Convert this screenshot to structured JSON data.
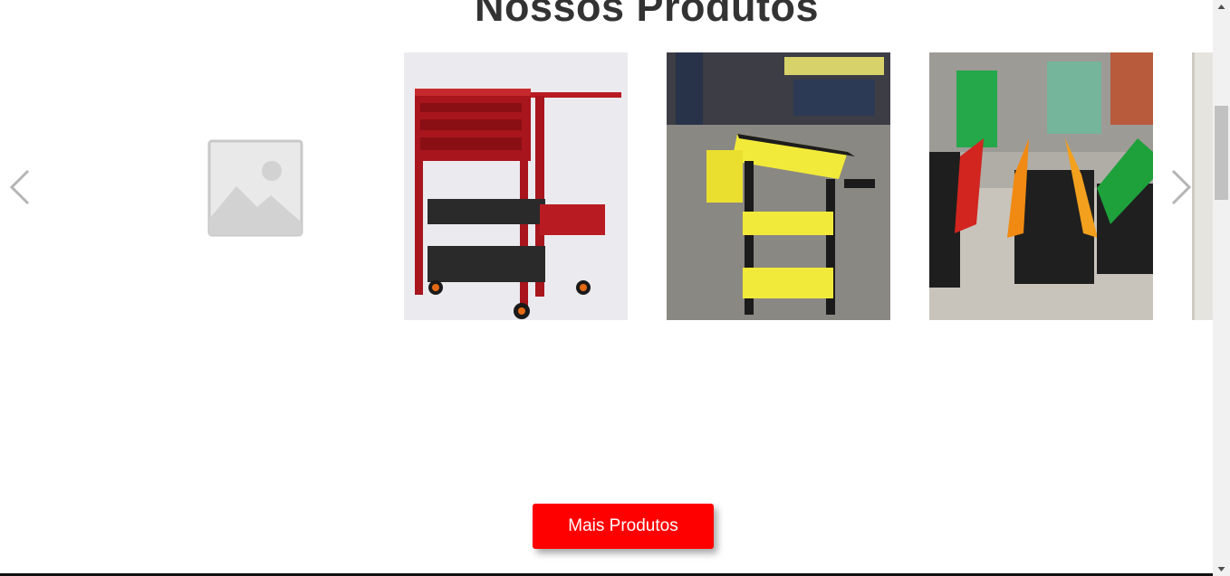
{
  "section": {
    "title": "Nossos Produtos"
  },
  "carousel": {
    "prev_icon": "chevron-left-icon",
    "next_icon": "chevron-right-icon",
    "products": [
      {
        "image": "placeholder-image-icon"
      },
      {
        "image": "red-tool-cart"
      },
      {
        "image": "yellow-black-tool-cart"
      },
      {
        "image": "cantilever-toolboxes"
      },
      {
        "image": "partial-product-image"
      }
    ]
  },
  "more_button": {
    "label": "Mais Produtos"
  },
  "colors": {
    "accent": "#ff0000",
    "title": "#333333"
  }
}
